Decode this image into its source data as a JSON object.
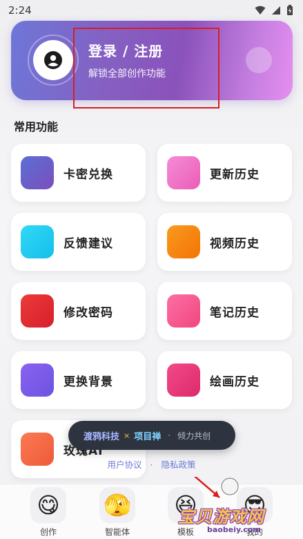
{
  "status_bar": {
    "time": "2:24"
  },
  "login": {
    "title": "登录 / 注册",
    "subtitle": "解锁全部创作功能"
  },
  "section_title": "常用功能",
  "features": [
    {
      "label": "卡密兑换",
      "color": "#6a5bc7"
    },
    {
      "label": "更新历史",
      "color": "#ef72c8"
    },
    {
      "label": "反馈建议",
      "color": "#22cdf0"
    },
    {
      "label": "视频历史",
      "color": "#f6850c"
    },
    {
      "label": "修改密码",
      "color": "#e32a2f"
    },
    {
      "label": "笔记历史",
      "color": "#f4558c"
    },
    {
      "label": "更换背景",
      "color": "#7a5ae8"
    },
    {
      "label": "绘画历史",
      "color": "#e8377a"
    },
    {
      "label": "玫瑰AI",
      "color": "#f46a45"
    }
  ],
  "toast": {
    "brand": "渡鸦科技",
    "separator": "×",
    "project": "项目禅",
    "dot": "·",
    "tagline": "倾力共创"
  },
  "footer": {
    "user_agreement": "用户协议",
    "separator": "·",
    "privacy_policy": "隐私政策"
  },
  "bottom_nav": [
    {
      "label": "创作",
      "icon": "grinning-face-icon",
      "glyph": "😋"
    },
    {
      "label": "智能体",
      "icon": "face-with-hands-icon",
      "glyph": "🫣"
    },
    {
      "label": "模板",
      "icon": "laughing-face-icon",
      "glyph": "😆"
    },
    {
      "label": "我的",
      "icon": "profile-icon",
      "glyph": "😎"
    }
  ],
  "watermark": {
    "text": "宝贝游戏网",
    "url": "baobeiy.com"
  }
}
